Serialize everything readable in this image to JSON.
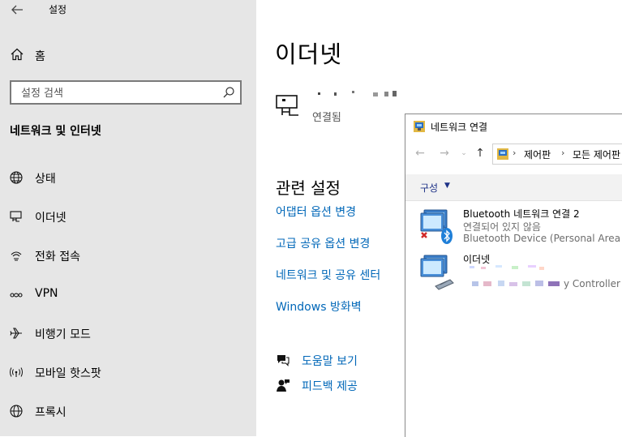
{
  "window": {
    "title": "설정"
  },
  "sidebar": {
    "home": "홈",
    "search_placeholder": "설정 검색",
    "section_title": "네트워크 및 인터넷",
    "items": [
      {
        "label": "상태",
        "icon": "globe-icon"
      },
      {
        "label": "이더넷",
        "icon": "ethernet-icon"
      },
      {
        "label": "전화 접속",
        "icon": "dialup-icon"
      },
      {
        "label": "VPN",
        "icon": "vpn-icon"
      },
      {
        "label": "비행기 모드",
        "icon": "airplane-icon"
      },
      {
        "label": "모바일 핫스팟",
        "icon": "hotspot-icon"
      },
      {
        "label": "프록시",
        "icon": "proxy-globe-icon"
      }
    ]
  },
  "main": {
    "title": "이더넷",
    "connection_status": "연결됨",
    "related_title": "관련 설정",
    "links": [
      "어댑터 옵션 변경",
      "고급 공유 옵션 변경",
      "네트워크 및 공유 센터",
      "Windows 방화벽"
    ],
    "help": "도움말 보기",
    "feedback": "피드백 제공"
  },
  "network_window": {
    "title": "네트워크 연결",
    "breadcrumb": [
      "제어판",
      "모든 제어판"
    ],
    "organize": "구성",
    "connections": [
      {
        "name": "Bluetooth 네트워크 연결 2",
        "status": "연결되어 있지 않음",
        "device": "Bluetooth Device (Personal Area"
      },
      {
        "name": "이더넷",
        "status": "",
        "device": "y Controller"
      }
    ]
  },
  "colors": {
    "sidebar_bg": "#e6e6e6",
    "link": "#0067b8",
    "accent": "#0063b1"
  }
}
